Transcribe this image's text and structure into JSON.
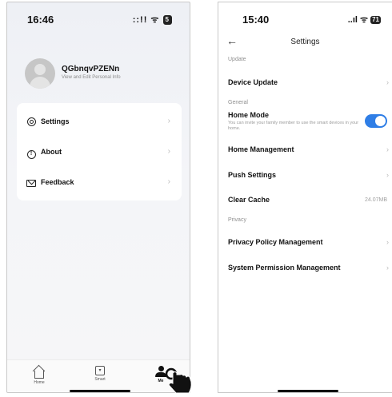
{
  "left": {
    "status": {
      "time": "16:46",
      "icons": "::!! ᯤ",
      "battery": "5"
    },
    "profile": {
      "name": "QGbnqvPZENn",
      "subtitle": "View and Edit Personal Info"
    },
    "menu": [
      {
        "label": "Settings",
        "icon": "gear-icon"
      },
      {
        "label": "About",
        "icon": "info-icon"
      },
      {
        "label": "Feedback",
        "icon": "mail-icon"
      }
    ],
    "tabs": [
      {
        "label": "Home",
        "icon": "home-icon"
      },
      {
        "label": "Smart",
        "icon": "smart-icon"
      },
      {
        "label": "Me",
        "icon": "me-icon",
        "active": true
      }
    ]
  },
  "right": {
    "status": {
      "time": "15:40",
      "icons": "..ıl ᯤ",
      "battery": "71"
    },
    "nav": {
      "title": "Settings",
      "back": "←"
    },
    "sections": {
      "update": "Update",
      "general": "General",
      "privacy": "Privacy"
    },
    "rows": {
      "device_update": "Device Update",
      "home_mode": "Home Mode",
      "home_mode_desc": "You can invite your family member to use the smart devices in your home.",
      "home_management": "Home Management",
      "push_settings": "Push Settings",
      "clear_cache": "Clear Cache",
      "cache_size": "24.07MB",
      "privacy_policy": "Privacy Policy Management",
      "system_permission": "System Permission Management"
    },
    "home_mode_enabled": true,
    "accent_color": "#2f7ee6"
  }
}
